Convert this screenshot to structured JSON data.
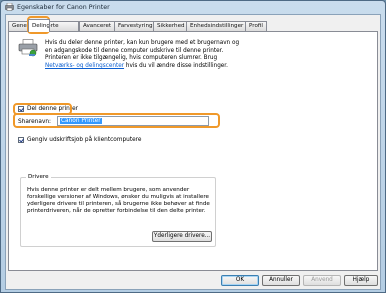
{
  "window": {
    "title": "Egenskaber for Canon Printer"
  },
  "tabs": [
    {
      "label": "Generelt",
      "active": false
    },
    {
      "label": "Deling",
      "active": true
    },
    {
      "label": "Porte",
      "active": false
    },
    {
      "label": "Avanceret",
      "active": false
    },
    {
      "label": "Farvestyring",
      "active": false
    },
    {
      "label": "Sikkerhed",
      "active": false
    },
    {
      "label": "Enhedsindstillinger",
      "active": false
    },
    {
      "label": "Profil",
      "active": false
    }
  ],
  "sharing": {
    "info_line1": "Hvis du deler denne printer, kan kun brugere med et brugernavn og",
    "info_line2": "en adgangskode til denne computer udskrive til denne printer.",
    "info_line3": "Printeren er ikke tilgængelig, hvis computeren slumrer. Brug",
    "info_link": "Netværks- og delingscenter",
    "info_line4_rest": " hvis du vil ændre disse indstillinger.",
    "share_checkbox_label": "Del denne printer",
    "share_checked": true,
    "sharename_label": "Sharenavn:",
    "sharename_value": "Canon Printer",
    "render_checkbox_label": "Gengiv udskriftsjob på klientcomputere",
    "render_checked": true
  },
  "drivers": {
    "group_title": "Drivere",
    "text_line1": "Hvis denne printer er delt mellem brugere, som anvender",
    "text_line2": "forskellige versioner af Windows, ønsker du muligvis at installere",
    "text_line3": "yderligere drivere til printeren, så brugerne ikke behøver at finde",
    "text_line4": "printerdriveren, når de opretter forbindelse til den delte printer.",
    "additional_button": "Yderligere drivere..."
  },
  "footer": {
    "ok": "OK",
    "cancel": "Annuller",
    "apply": "Anvend",
    "help": "Hjælp"
  },
  "colors": {
    "highlight_ring": "#f0992a",
    "selection": "#3399ff",
    "link": "#0c5fd0"
  }
}
